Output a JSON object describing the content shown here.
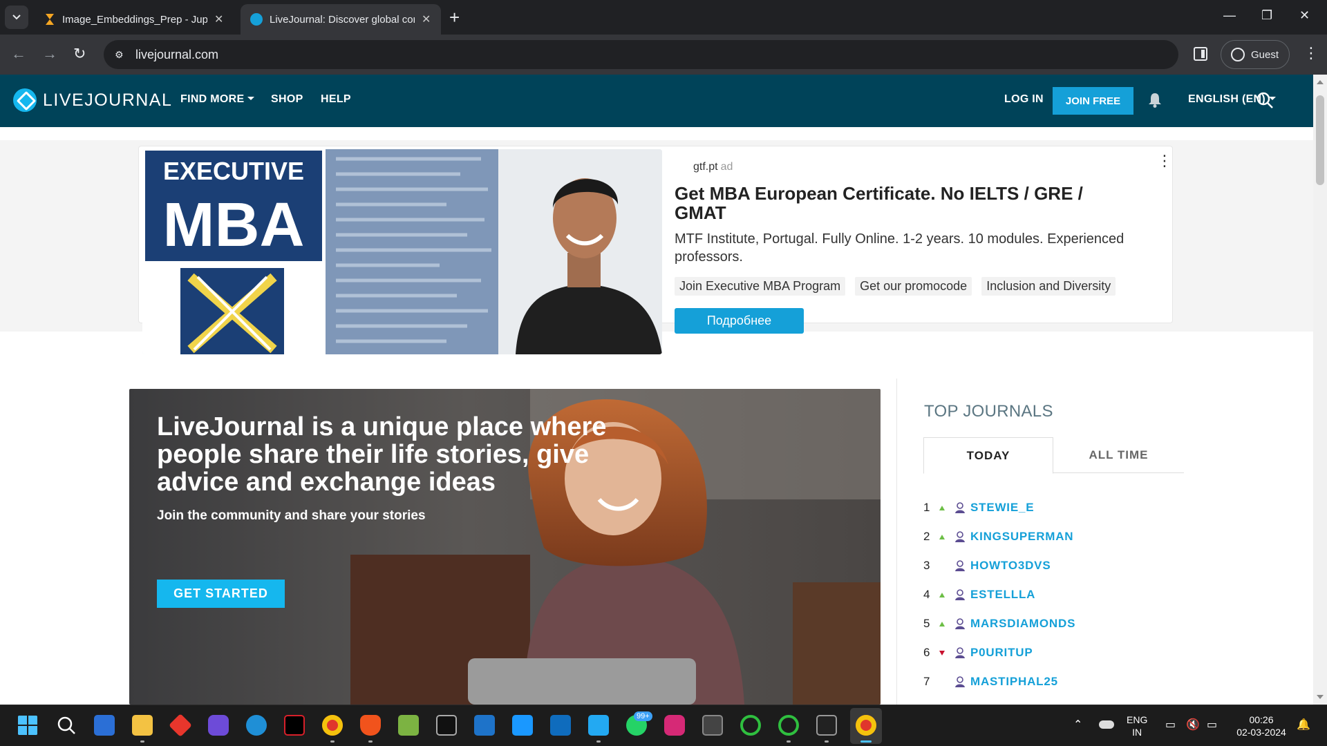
{
  "browser": {
    "tabs": [
      {
        "title": "Image_Embeddings_Prep - Jupy"
      },
      {
        "title": "LiveJournal: Discover global cor"
      }
    ],
    "url": "livejournal.com",
    "profile_label": "Guest"
  },
  "site": {
    "logo_text": "LIVEJOURNAL",
    "nav": {
      "find_more": "FIND MORE",
      "shop": "SHOP",
      "help": "HELP",
      "login": "LOG IN",
      "join": "JOIN FREE",
      "language": "ENGLISH (EN)"
    },
    "colors": {
      "header": "#004359",
      "accent": "#15a0d8"
    }
  },
  "ad": {
    "image_text_top": "EXECUTIVE",
    "image_text_big": "MBA",
    "source": "gtf.pt",
    "label": "ad",
    "title": "Get MBA European Certificate. No IELTS / GRE / GMAT",
    "description": "MTF Institute, Portugal. Fully Online. 1-2 years. 10 modules. Experienced professors.",
    "chips": [
      "Join Executive MBA Program",
      "Get our promocode",
      "Inclusion and Diversity"
    ],
    "cta": "Подробнее"
  },
  "hero": {
    "title": "LiveJournal is a unique place where people share their life stories, give advice and exchange ideas",
    "subtitle": "Join the community and share your stories",
    "cta": "GET STARTED"
  },
  "top_journals": {
    "heading": "TOP JOURNALS",
    "tab_today": "TODAY",
    "tab_all_time": "ALL TIME",
    "entries": [
      {
        "rank": "1",
        "trend": "up",
        "name": "STEWIE_E"
      },
      {
        "rank": "2",
        "trend": "up",
        "name": "KINGSUPERMAN"
      },
      {
        "rank": "3",
        "trend": "none",
        "name": "HOWTO3DVS"
      },
      {
        "rank": "4",
        "trend": "up",
        "name": "ESTELLLA"
      },
      {
        "rank": "5",
        "trend": "up",
        "name": "MARSDIAMONDS"
      },
      {
        "rank": "6",
        "trend": "down",
        "name": "P0URITUP"
      },
      {
        "rank": "7",
        "trend": "none",
        "name": "MASTIPHAL25"
      }
    ]
  },
  "taskbar": {
    "badge": "99+",
    "lang_line1": "ENG",
    "lang_line2": "IN",
    "time": "00:26",
    "date": "02-03-2024"
  }
}
